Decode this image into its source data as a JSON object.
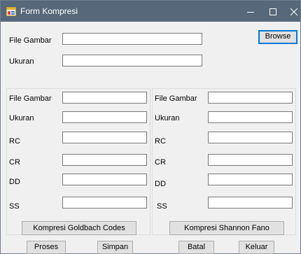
{
  "window": {
    "title": "Form Kompresi",
    "icon": "app-form-icon",
    "controls": [
      "minimize-icon",
      "maximize-icon",
      "close-icon"
    ]
  },
  "top": {
    "file_label": "File Gambar",
    "file_value": "",
    "size_label": "Ukuran",
    "size_value": "",
    "browse_label": "Browse"
  },
  "left_group": {
    "fields": [
      {
        "label": "File Gambar",
        "value": ""
      },
      {
        "label": "Ukuran",
        "value": ""
      },
      {
        "label": "RC",
        "value": ""
      },
      {
        "label": "CR",
        "value": ""
      },
      {
        "label": "DD",
        "value": ""
      },
      {
        "label": "SS",
        "value": ""
      }
    ],
    "button_label": "Kompresi Goldbach Codes"
  },
  "right_group": {
    "fields": [
      {
        "label": "File Gambar",
        "value": ""
      },
      {
        "label": "Ukuran",
        "value": ""
      },
      {
        "label": "RC",
        "value": ""
      },
      {
        "label": "CR",
        "value": ""
      },
      {
        "label": "DD",
        "value": ""
      },
      {
        "label": "SS",
        "value": ""
      }
    ],
    "button_label": "Kompresi Shannon Fano"
  },
  "bottom_buttons": {
    "proses": "Proses",
    "simpan": "Simpan",
    "batal": "Batal",
    "keluar": "Keluar"
  },
  "colors": {
    "titlebar": "#57687b",
    "window_bg": "#f0f0f0",
    "accent": "#0078d7"
  }
}
